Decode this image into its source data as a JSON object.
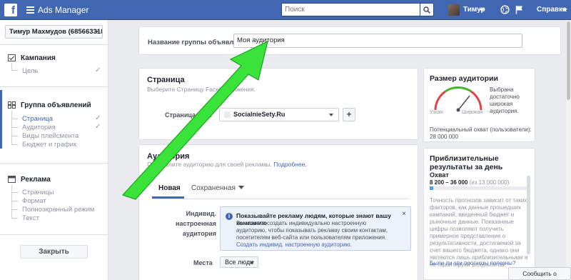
{
  "topbar": {
    "logo": "f",
    "app_title": "Ads Manager",
    "search_placeholder": "Поиск",
    "user_name": "Тимур",
    "help_label": "Справка"
  },
  "sidebar": {
    "account": "Тимур Махмудов (6856633181...",
    "sections": [
      {
        "title": "Кампания",
        "items": [
          {
            "label": "Цель",
            "checked": true
          }
        ]
      },
      {
        "title": "Группа объявлений",
        "items": [
          {
            "label": "Страница",
            "checked": true,
            "active": true
          },
          {
            "label": "Аудитория",
            "checked": true
          },
          {
            "label": "Виды плейсмента",
            "checked": false
          },
          {
            "label": "Бюджет и график",
            "checked": false
          }
        ]
      },
      {
        "title": "Реклама",
        "items": [
          {
            "label": "Страницы",
            "checked": false
          },
          {
            "label": "Формат",
            "checked": false
          },
          {
            "label": "Полноэкранный режим",
            "checked": false
          },
          {
            "label": "Текст",
            "checked": false
          }
        ]
      }
    ],
    "check_glyph": "✓",
    "close_label": "Закрыть"
  },
  "adset": {
    "label": "Название группы объявлений",
    "value": "Моя аудитория"
  },
  "page_section": {
    "title": "Страница",
    "subtitle": "Выберите Страницу Faceb",
    "subtitle_tail": "движения.",
    "field_label": "Страница Face",
    "selected_page": "SocialnieSety.Ru",
    "plus_label": "+"
  },
  "audience": {
    "title": "Аудитория",
    "subtitle": "Определите аудиторию для своей рекламы.",
    "subtitle_link": "Подробнее.",
    "tabs": {
      "new": "Новая",
      "saved": "Сохраненная"
    },
    "custom_label": "Индивид. настроенная аудитория",
    "info": {
      "title": "Показывайте рекламу людям, которые знают вашу компанию",
      "body": "Вы можете создать индивидуально настроенную аудиторию, чтобы показывать рекламу своим контактам, посетителям веб-сайта или пользователям приложения.",
      "link": "Создать индивид. настроенную аудиторию.",
      "close": "×"
    },
    "places_label": "Места",
    "places_value": "Все люди"
  },
  "audience_size": {
    "title": "Размер аудитории",
    "gauge_text": "Выбрана достаточно широкая аудитория.",
    "narrow": "Узкая",
    "wide": "Широкая",
    "reach_label": "Потенциальный охват (пользователи):",
    "reach_value": "28 000 000"
  },
  "estimates": {
    "title": "Приблизительные результаты за день",
    "reach_label": "Охват",
    "range": "8 200 – 36 000",
    "range_total": "(из 13 000 000)",
    "bar_fraction": 0.04,
    "text": "Точность прогнозов зависит от таких факторов, как данные прошедших кампаний, введенный бюджет и рыночные данные. Показанные цифры позволяют получить примерное представление о результативности, достигаемой за счет вашего бюджета, однако они являются лишь приблизительными и не гарантируют результатов.",
    "link": "Были ли эти прогнозы полезны?"
  },
  "report_label": "Сообщить о проблеме",
  "colors": {
    "brand": "#4267b2",
    "arrow": "#39e33a"
  }
}
